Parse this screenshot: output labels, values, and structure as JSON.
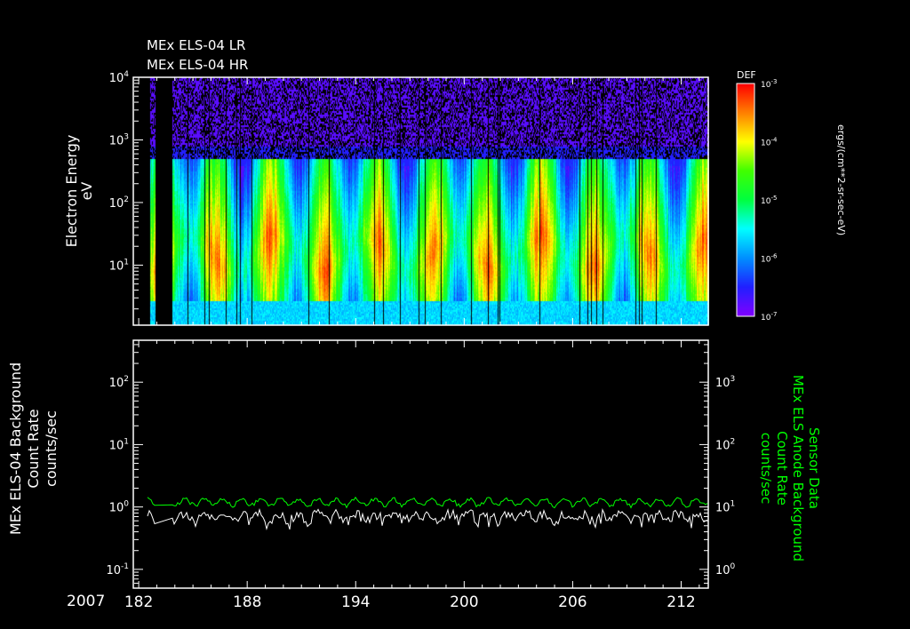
{
  "chart_data": [
    {
      "type": "heatmap",
      "title_lines": [
        "MEx ELS-04 LR",
        "MEx ELS-04 HR"
      ],
      "ylabel": "Electron Energy",
      "yunit": "eV",
      "yscale": "log",
      "ylim": [
        1.1,
        10000
      ],
      "yticks": [
        {
          "exp": "1"
        },
        {
          "exp": "2"
        },
        {
          "exp": "3"
        },
        {
          "exp": "4"
        }
      ],
      "xlim": [
        181.75,
        213.5
      ],
      "data_gaps": [
        [
          181.75,
          182.55
        ],
        [
          182.9,
          183.85
        ]
      ],
      "colorbar": {
        "title": "DEF",
        "label": "ergs/(cm**2-sr-sec-eV)",
        "scale": "log",
        "range": [
          1e-07,
          0.001
        ],
        "ticks": [
          {
            "exp": "-7"
          },
          {
            "exp": "-6"
          },
          {
            "exp": "-5"
          },
          {
            "exp": "-4"
          },
          {
            "exp": "-3"
          }
        ],
        "colors": [
          "#8000ff",
          "#2020ff",
          "#0090ff",
          "#00ffff",
          "#00ff40",
          "#40ff00",
          "#ffff00",
          "#ff8000",
          "#ff0000"
        ]
      }
    },
    {
      "type": "line",
      "ylabel_left": [
        "MEx ELS-04 Background",
        "Count Rate",
        "counts/sec"
      ],
      "ylabel_right": [
        "MEx ELS Anode Background",
        "Count Rate",
        "counts/sec"
      ],
      "ylabel_right_header": "Sensor Data",
      "yscale": "log",
      "ylim_left": [
        0.05,
        470
      ],
      "ylim_right": [
        0.5,
        4700
      ],
      "yticks_left": [
        {
          "exp": "-1"
        },
        {
          "exp": "0"
        },
        {
          "exp": "1"
        },
        {
          "exp": "2"
        }
      ],
      "yticks_right": [
        {
          "exp": "0"
        },
        {
          "exp": "1"
        },
        {
          "exp": "2"
        },
        {
          "exp": "3"
        }
      ],
      "series": [
        {
          "name": "ELS-04 background",
          "color": "#ffffff",
          "axis": "left",
          "typical_value": 0.7
        },
        {
          "name": "Anode background",
          "color": "#00ff00",
          "axis": "right",
          "typical_value": 12
        }
      ],
      "xlabel_year": "2007",
      "xticks": [
        "182",
        "188",
        "194",
        "200",
        "206",
        "212"
      ],
      "xlim": [
        181.75,
        213.5
      ]
    }
  ]
}
